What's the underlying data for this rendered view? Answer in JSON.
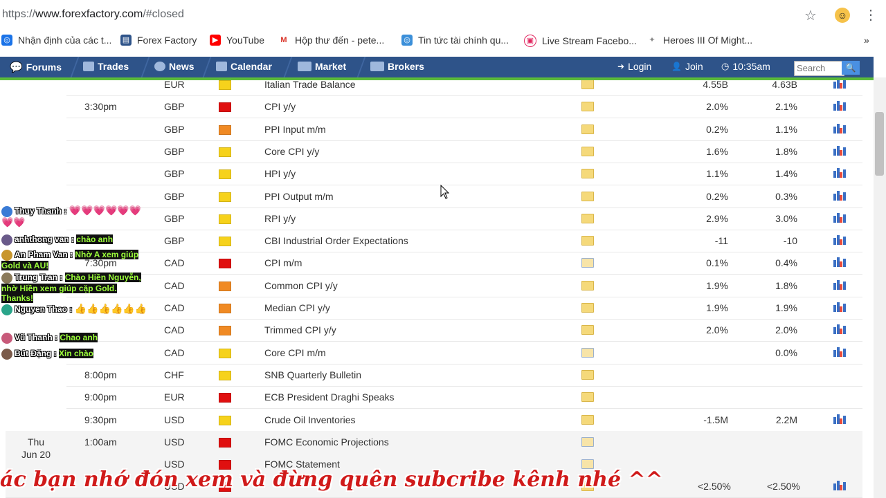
{
  "browser": {
    "url_scheme": "https://",
    "url_host": "www.forexfactory.com",
    "url_rest": "/#closed",
    "bookmarks": [
      {
        "label": "Nhận định của các t...",
        "icon": "globe-icon"
      },
      {
        "label": "Forex Factory",
        "icon": "forexfactory-icon"
      },
      {
        "label": "YouTube",
        "icon": "youtube-icon"
      },
      {
        "label": "Hộp thư đến - pete...",
        "icon": "gmail-icon"
      },
      {
        "label": "Tin tức tài chính qu...",
        "icon": "globe-icon"
      },
      {
        "label": "Live Stream Facebo...",
        "icon": "livestream-icon"
      },
      {
        "label": "Heroes III Of Might...",
        "icon": "lightbulb-icon"
      }
    ],
    "more_label": "»"
  },
  "nav": {
    "items": [
      {
        "label": "Forums",
        "icon": "chat-icon"
      },
      {
        "label": "Trades",
        "icon": "chart-icon"
      },
      {
        "label": "News",
        "icon": "globe-icon"
      },
      {
        "label": "Calendar",
        "icon": "calendar-icon"
      },
      {
        "label": "Market",
        "icon": "picture-icon"
      },
      {
        "label": "Brokers",
        "icon": "building-icon"
      }
    ],
    "login": "Login",
    "join": "Join",
    "time": "10:35am",
    "search_placeholder": "Search"
  },
  "calendar": {
    "day": {
      "weekday": "Thu",
      "date": "Jun 20"
    },
    "rows": [
      {
        "time": "",
        "currency": "EUR",
        "impact": "low",
        "event": "Italian Trade Balance",
        "actual": "4.55B",
        "forecast": "4.63B",
        "graph": true,
        "detail": "folder"
      },
      {
        "time": "3:30pm",
        "currency": "GBP",
        "impact": "high",
        "event": "CPI y/y",
        "actual": "2.0%",
        "forecast": "2.1%",
        "graph": true,
        "detail": "folder"
      },
      {
        "time": "",
        "currency": "GBP",
        "impact": "medium",
        "event": "PPI Input m/m",
        "actual": "0.2%",
        "forecast": "1.1%",
        "graph": true,
        "detail": "folder"
      },
      {
        "time": "",
        "currency": "GBP",
        "impact": "low",
        "event": "Core CPI y/y",
        "actual": "1.6%",
        "forecast": "1.8%",
        "graph": true,
        "detail": "folder"
      },
      {
        "time": "",
        "currency": "GBP",
        "impact": "low",
        "event": "HPI y/y",
        "actual": "1.1%",
        "forecast": "1.4%",
        "graph": true,
        "detail": "folder"
      },
      {
        "time": "",
        "currency": "GBP",
        "impact": "low",
        "event": "PPI Output m/m",
        "actual": "0.2%",
        "forecast": "0.3%",
        "graph": true,
        "detail": "folder"
      },
      {
        "time": "",
        "currency": "GBP",
        "impact": "low",
        "event": "RPI y/y",
        "actual": "2.9%",
        "forecast": "3.0%",
        "graph": true,
        "detail": "folder"
      },
      {
        "time": "",
        "currency": "GBP",
        "impact": "low",
        "event": "CBI Industrial Order Expectations",
        "actual": "-11",
        "forecast": "-10",
        "graph": true,
        "detail": "folder"
      },
      {
        "time": "7:30pm",
        "currency": "CAD",
        "impact": "high",
        "event": "CPI m/m",
        "actual": "0.1%",
        "forecast": "0.4%",
        "graph": true,
        "detail": "folder-open"
      },
      {
        "time": "",
        "currency": "CAD",
        "impact": "medium",
        "event": "Common CPI y/y",
        "actual": "1.9%",
        "forecast": "1.8%",
        "graph": true,
        "detail": "folder"
      },
      {
        "time": "",
        "currency": "CAD",
        "impact": "medium",
        "event": "Median CPI y/y",
        "actual": "1.9%",
        "forecast": "1.9%",
        "graph": true,
        "detail": "folder"
      },
      {
        "time": "",
        "currency": "CAD",
        "impact": "medium",
        "event": "Trimmed CPI y/y",
        "actual": "2.0%",
        "forecast": "2.0%",
        "graph": true,
        "detail": "folder"
      },
      {
        "time": "",
        "currency": "CAD",
        "impact": "low",
        "event": "Core CPI m/m",
        "actual": "",
        "forecast": "0.0%",
        "graph": true,
        "detail": "folder-open"
      },
      {
        "time": "8:00pm",
        "currency": "CHF",
        "impact": "low",
        "event": "SNB Quarterly Bulletin",
        "actual": "",
        "forecast": "",
        "graph": false,
        "detail": "folder"
      },
      {
        "time": "9:00pm",
        "currency": "EUR",
        "impact": "high",
        "event": "ECB President Draghi Speaks",
        "actual": "",
        "forecast": "",
        "graph": false,
        "detail": "folder"
      },
      {
        "time": "9:30pm",
        "currency": "USD",
        "impact": "low",
        "event": "Crude Oil Inventories",
        "actual": "-1.5M",
        "forecast": "2.2M",
        "graph": true,
        "detail": "folder"
      },
      {
        "time": "1:00am",
        "currency": "USD",
        "impact": "high",
        "event": "FOMC Economic Projections",
        "actual": "",
        "forecast": "",
        "graph": false,
        "detail": "folder-open"
      },
      {
        "time": "",
        "currency": "USD",
        "impact": "high",
        "event": "FOMC Statement",
        "actual": "",
        "forecast": "",
        "graph": false,
        "detail": "folder-open"
      },
      {
        "time": "",
        "currency": "USD",
        "impact": "high",
        "event": "",
        "actual": "<2.50%",
        "forecast": "<2.50%",
        "graph": true,
        "detail": "folder"
      }
    ]
  },
  "impact_colors": {
    "high": "#e01010",
    "medium": "#f08a24",
    "low": "#f6d21c"
  },
  "chat": [
    {
      "name": "Thuy Thanh :",
      "message": "💗💗💗💗💗💗💗💗",
      "style": "hearts",
      "avatar": "#3a7bd5"
    },
    {
      "name": "anhthong van :",
      "message": "chào anh",
      "style": "green",
      "avatar": "#6a5a8a"
    },
    {
      "name": "An Pham Van :",
      "message": "Nhờ A xem giúp Gold và AU!",
      "style": "green",
      "avatar": "#c8962c"
    },
    {
      "name": "Trung Tran :",
      "message": "Chào Hiền Nguyễn, nhờ Hiền xem giúp cặp Gold. Thanks!",
      "style": "green",
      "avatar": "#8a7a5a"
    },
    {
      "name": "Nguyen Thao :",
      "message": "👍👍👍👍👍👍",
      "style": "thumbs",
      "avatar": "#2aa58a"
    },
    {
      "name": "Vũ Thanh :",
      "message": "Chao anh",
      "style": "green",
      "avatar": "#c85a7a"
    },
    {
      "name": "Bút Đặng :",
      "message": "Xin chào",
      "style": "green",
      "avatar": "#7a5a4a"
    }
  ],
  "caption": "ác bạn nhớ đón xem và đừng quên subcribe kênh nhé ^^"
}
